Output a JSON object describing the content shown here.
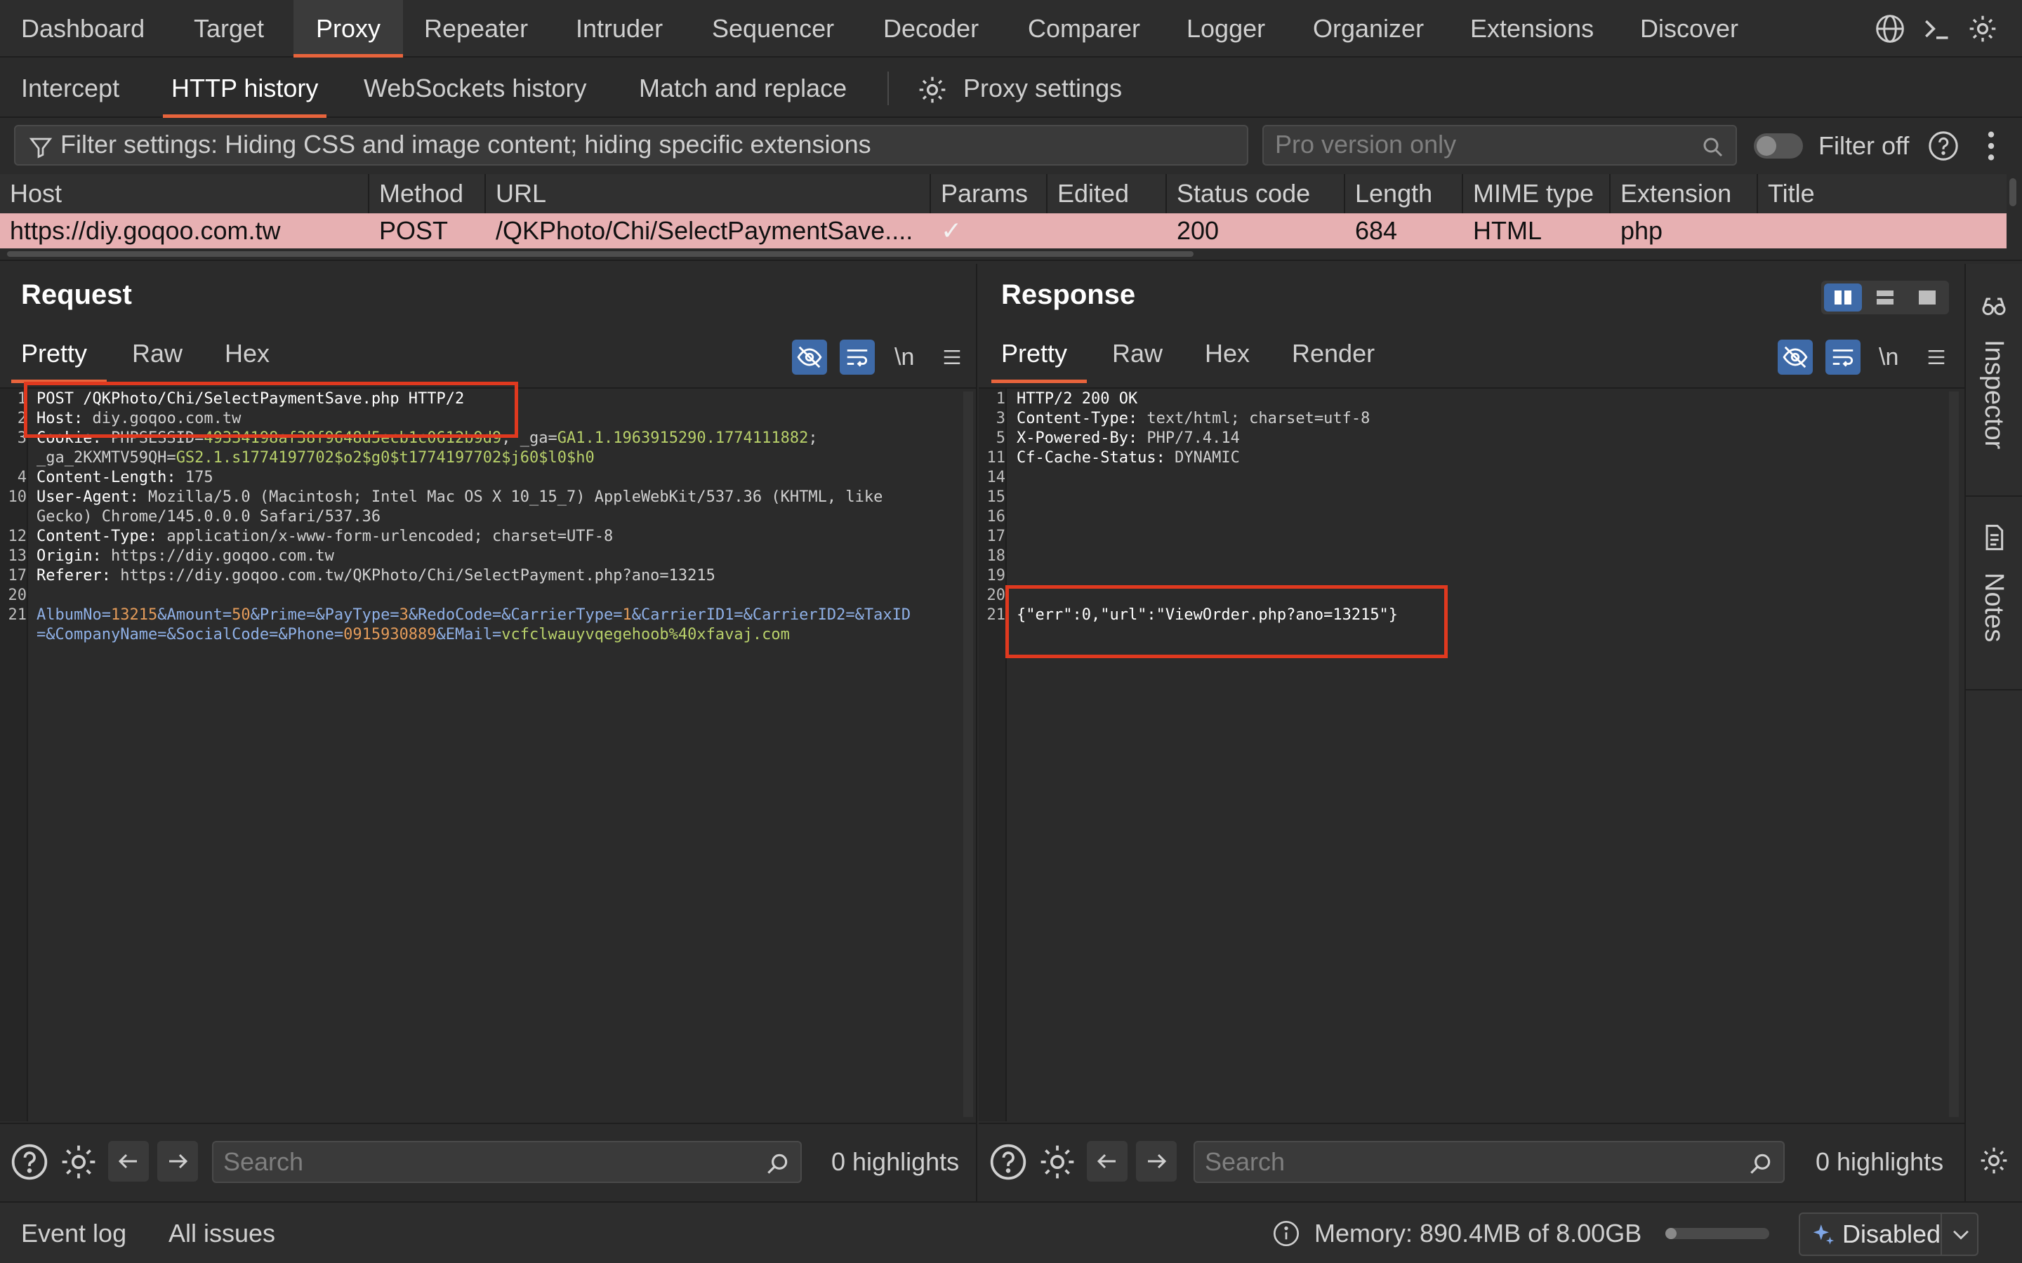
{
  "nav": {
    "tabs": [
      "Dashboard",
      "Target",
      "Proxy",
      "Repeater",
      "Intruder",
      "Sequencer",
      "Decoder",
      "Comparer",
      "Logger",
      "Organizer",
      "Extensions",
      "Discover"
    ],
    "active": "Proxy"
  },
  "subnav": {
    "tabs": [
      "Intercept",
      "HTTP history",
      "WebSockets history",
      "Match and replace"
    ],
    "active": "HTTP history",
    "settings_label": "Proxy settings"
  },
  "filter": {
    "text": "Filter settings: Hiding CSS and image content; hiding specific extensions",
    "search_placeholder": "Pro version only",
    "toggle_label": "Filter off"
  },
  "table": {
    "columns": [
      "Host",
      "Method",
      "URL",
      "Params",
      "Edited",
      "Status code",
      "Length",
      "MIME type",
      "Extension",
      "Title"
    ],
    "row": {
      "host": "https://diy.goqoo.com.tw",
      "method": "POST",
      "url": "/QKPhoto/Chi/SelectPaymentSave....",
      "params": "✓",
      "edited": "",
      "status": "200",
      "length": "684",
      "mime": "HTML",
      "extension": "php",
      "title": ""
    }
  },
  "request": {
    "title": "Request",
    "tabs": [
      "Pretty",
      "Raw",
      "Hex"
    ],
    "newline_label": "\\n",
    "line_numbers": [
      "1",
      "2",
      "3",
      "4",
      "10",
      "12",
      "13",
      "17",
      "20",
      "21"
    ],
    "lines": {
      "l1": "POST /QKPhoto/Chi/SelectPaymentSave.php HTTP/2",
      "l2_key": "Host:",
      "l2_val": " diy.goqoo.com.tw",
      "l3_key": "Cookie:",
      "l3_a": " PHPSESSID=",
      "l3_b": "49334198af38f9648d5ecb1c0612b9d9",
      "l3_c": "; _ga=",
      "l3_d": "GA1.1.1963915290.1774111882",
      "l3_e": ";",
      "l3b_a": "_ga_2KXMTV59QH=",
      "l3b_b": "GS2.1.s1774197702$o2$g0$t1774197702$j60$l0$h0",
      "l4_key": "Content-Length:",
      "l4_val": " 175",
      "l10_key": "User-Agent:",
      "l10_val": " Mozilla/5.0 (Macintosh; Intel Mac OS X 10_15_7) AppleWebKit/537.36 (KHTML, like",
      "l10b": "Gecko) Chrome/145.0.0.0 Safari/537.36",
      "l12_key": "Content-Type:",
      "l12_val": " application/x-www-form-urlencoded; charset=UTF-8",
      "l13_key": "Origin:",
      "l13_val": " https://diy.goqoo.com.tw",
      "l17_key": "Referer:",
      "l17_val": " https://diy.goqoo.com.tw/QKPhoto/Chi/SelectPayment.php?ano=13215",
      "b1": "AlbumNo=",
      "b2": "13215",
      "b3": "&Amount=",
      "b4": "50",
      "b5": "&Prime=&PayType=",
      "b6": "3",
      "b7": "&RedoCode=&CarrierType=",
      "b8": "1",
      "b9": "&CarrierID1=&CarrierID2=&TaxID",
      "c1": "=&CompanyName=&SocialCode=&Phone=",
      "c2": "0915930889",
      "c3": "&EMail=",
      "c4": "vcfclwauyvqegehoob%40xfavaj.com"
    }
  },
  "response": {
    "title": "Response",
    "tabs": [
      "Pretty",
      "Raw",
      "Hex",
      "Render"
    ],
    "newline_label": "\\n",
    "line_numbers": [
      "1",
      "3",
      "5",
      "11",
      "14",
      "15",
      "16",
      "17",
      "18",
      "19",
      "20",
      "21"
    ],
    "lines": {
      "l1": "HTTP/2 200 OK",
      "l3_key": "Content-Type:",
      "l3_val": " text/html; charset=utf-8",
      "l5_key": "X-Powered-By:",
      "l5_val": " PHP/7.4.14",
      "l11_key": "Cf-Cache-Status:",
      "l11_val": " DYNAMIC",
      "l21": "{\"err\":0,\"url\":\"ViewOrder.php?ano=13215\"}"
    }
  },
  "bottom": {
    "search_placeholder": "Search",
    "highlights": "0 highlights"
  },
  "status": {
    "event_log": "Event log",
    "all_issues": "All issues",
    "memory": "Memory: 890.4MB of 8.00GB",
    "memory_fraction": 0.11,
    "ai_label": "Disabled"
  },
  "rail": {
    "inspector": "Inspector",
    "notes": "Notes"
  },
  "colors": {
    "accent": "#e8643c",
    "highlight_row": "#e7b0b2",
    "annotation": "#e0391f",
    "toggle_active": "#3e6aa8"
  }
}
